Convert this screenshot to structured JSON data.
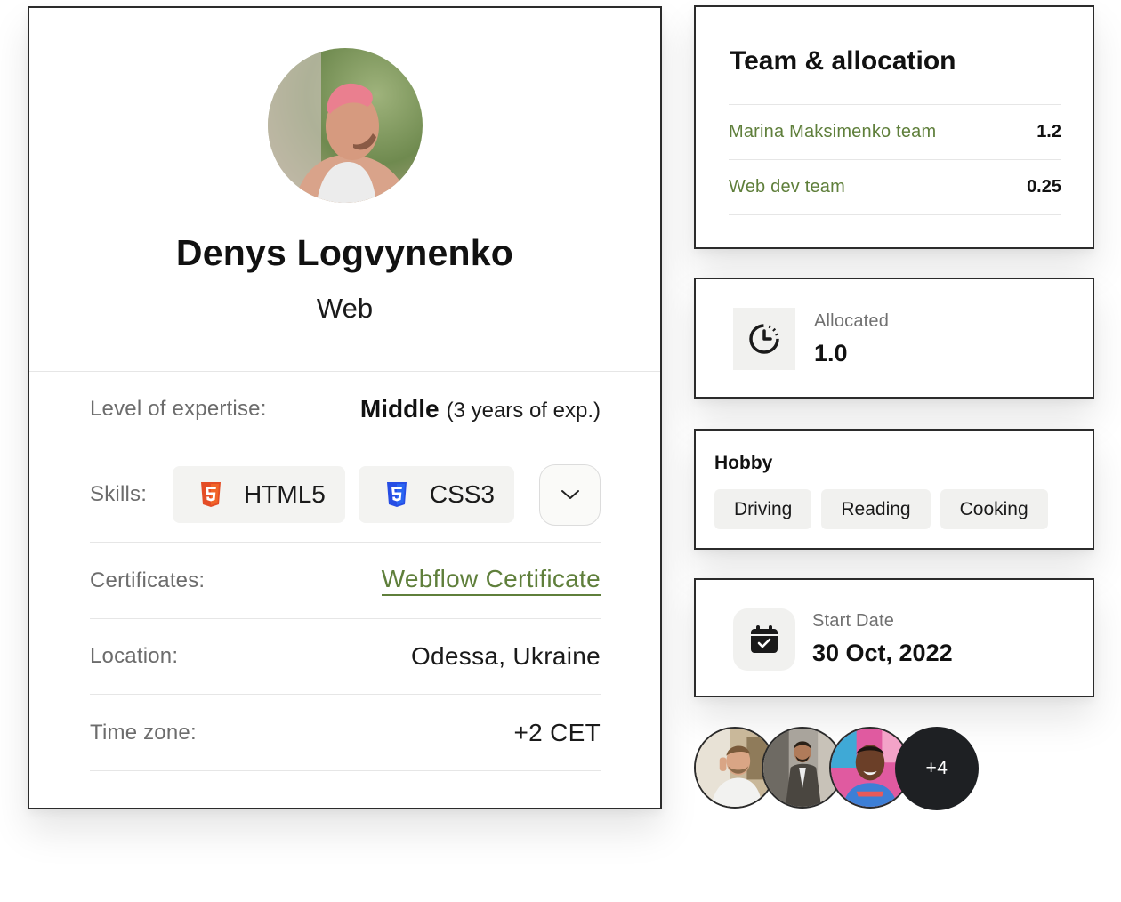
{
  "profile": {
    "name": "Denys Logvynenko",
    "role": "Web",
    "avatar_icon": "person-photo",
    "fields": {
      "expertise_label": "Level of expertise:",
      "expertise_level": "Middle",
      "expertise_years": "(3 years of exp.)",
      "skills_label": "Skills:",
      "skills": [
        {
          "label": "HTML5",
          "icon": "html5-icon",
          "color": "#e44d26"
        },
        {
          "label": "CSS3",
          "icon": "css3-icon",
          "color": "#264de4"
        }
      ],
      "skills_toggle_icon": "chevron-down-icon",
      "certificates_label": "Certificates:",
      "certificate": "Webflow Certificate",
      "location_label": "Location:",
      "location": "Odessa, Ukraine",
      "timezone_label": "Time zone:",
      "timezone": "+2 CET"
    }
  },
  "team": {
    "title": "Team & allocation",
    "rows": [
      {
        "name": "Marina Maksimenko team",
        "allocation": "1.2"
      },
      {
        "name": "Web dev team",
        "allocation": "0.25"
      }
    ]
  },
  "allocated": {
    "label": "Allocated",
    "value": "1.0",
    "icon": "timer-icon"
  },
  "hobby": {
    "title": "Hobby",
    "items": [
      "Driving",
      "Reading",
      "Cooking"
    ]
  },
  "start_date": {
    "label": "Start Date",
    "value": "30 Oct, 2022",
    "icon": "calendar-check-icon"
  },
  "members": {
    "more_count": "+4"
  },
  "colors": {
    "accent_green": "#5f7f3b",
    "border_dark": "#2b2b2b",
    "chip_bg": "#f3f3f1",
    "dark_badge": "#1e2023"
  }
}
